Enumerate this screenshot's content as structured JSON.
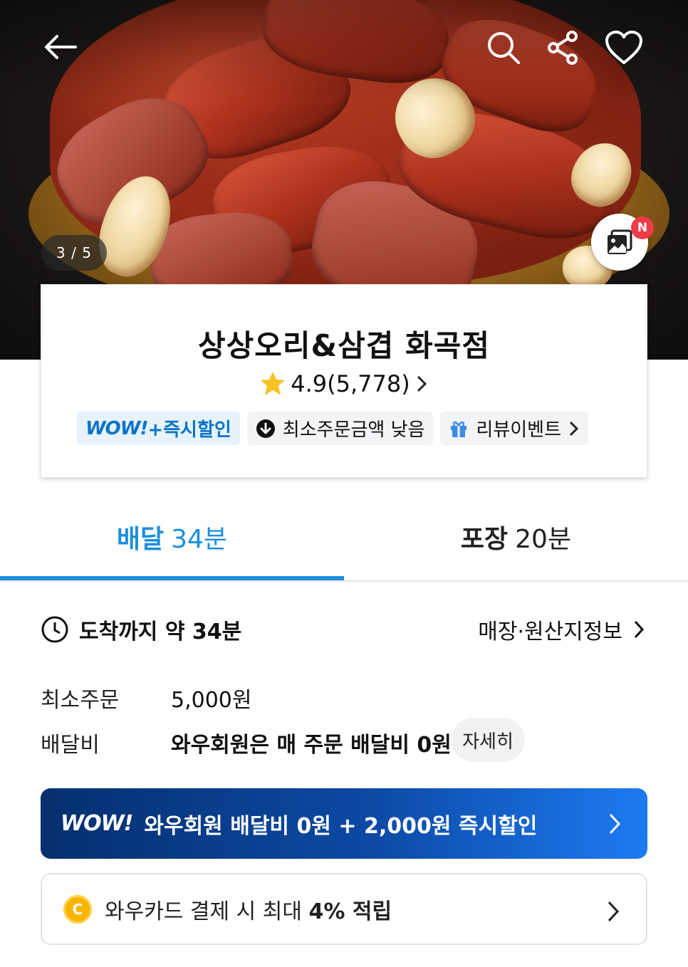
{
  "hero": {
    "pager": "3 / 5",
    "photo_badge": "N",
    "icons": [
      "back-arrow-icon",
      "search-icon",
      "share-icon",
      "heart-icon",
      "photo-gallery-icon"
    ]
  },
  "store": {
    "name": "상상오리&삼겹 화곡점",
    "rating": "4.9",
    "review_count": "(5,778)",
    "badges": {
      "wow_logo": "WOW!",
      "wow_text": "+즉시할인",
      "min_order": "최소주문금액 낮음",
      "review_event": "리뷰이벤트"
    }
  },
  "tabs": {
    "delivery_label": "배달",
    "delivery_time": "34분",
    "pickup_label": "포장",
    "pickup_time": "20분"
  },
  "info": {
    "eta_text": "도착까지 약 34분",
    "origin_link": "매장·원산지정보",
    "min_order_label": "최소주문",
    "min_order_value": "5,000원",
    "delivery_fee_label": "배달비",
    "delivery_fee_value": "와우회원은 매 주문 배달비 0원",
    "detail_button": "자세히"
  },
  "banners": {
    "wow_logo": "WOW!",
    "wow_text": "와우회원 배달비 0원 + 2,000원 즉시할인",
    "card_coin": "C",
    "card_text_prefix": "와우카드 결제 시 최대 ",
    "card_text_bold": "4% 적립"
  },
  "colors": {
    "accent": "#1c8fde",
    "wow_blue": "#0a73c8",
    "badge_red": "#ee3b48",
    "star": "#f7c325"
  }
}
